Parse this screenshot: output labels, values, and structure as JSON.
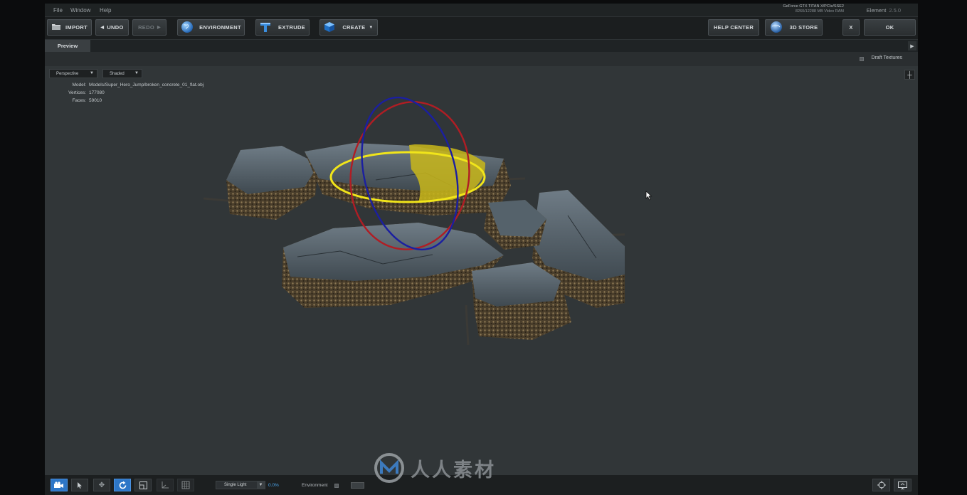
{
  "menu": [
    "File",
    "Window",
    "Help"
  ],
  "gpu": {
    "line1": "GeForce GTX TITAN X/PCIe/SSE2",
    "line2": "8260/12288 MB Video RAM"
  },
  "app": {
    "name": "Element",
    "version": "2.5.0"
  },
  "toolbar": {
    "import": "IMPORT",
    "undo": "UNDO",
    "redo": "REDO",
    "environment": "ENVIRONMENT",
    "extrude": "EXTRUDE",
    "create": "CREATE",
    "help_center": "HELP CENTER",
    "store": "3D STORE",
    "close": "X",
    "ok": "OK"
  },
  "tabs": {
    "preview": "Preview"
  },
  "options": {
    "draft_textures": "Draft Textures"
  },
  "viewport": {
    "camera": "Perspective",
    "shading": "Shaded",
    "info": [
      {
        "key": "Model:",
        "value": "Models/Super_Hero_Jump/broken_concrete_01_flat.obj"
      },
      {
        "key": "Vertices:",
        "value": "177080"
      },
      {
        "key": "Faces:",
        "value": "59010"
      }
    ]
  },
  "bottom": {
    "light": "Single Light",
    "light_value": "0.0%",
    "environment": "Environment"
  },
  "watermark": {
    "text": "人人素材"
  },
  "colors": {
    "accent": "#2d76c7",
    "gizmo_red": "#b01d24",
    "gizmo_blue": "#1b1fa0",
    "gizmo_yellow": "#f0e21a"
  }
}
